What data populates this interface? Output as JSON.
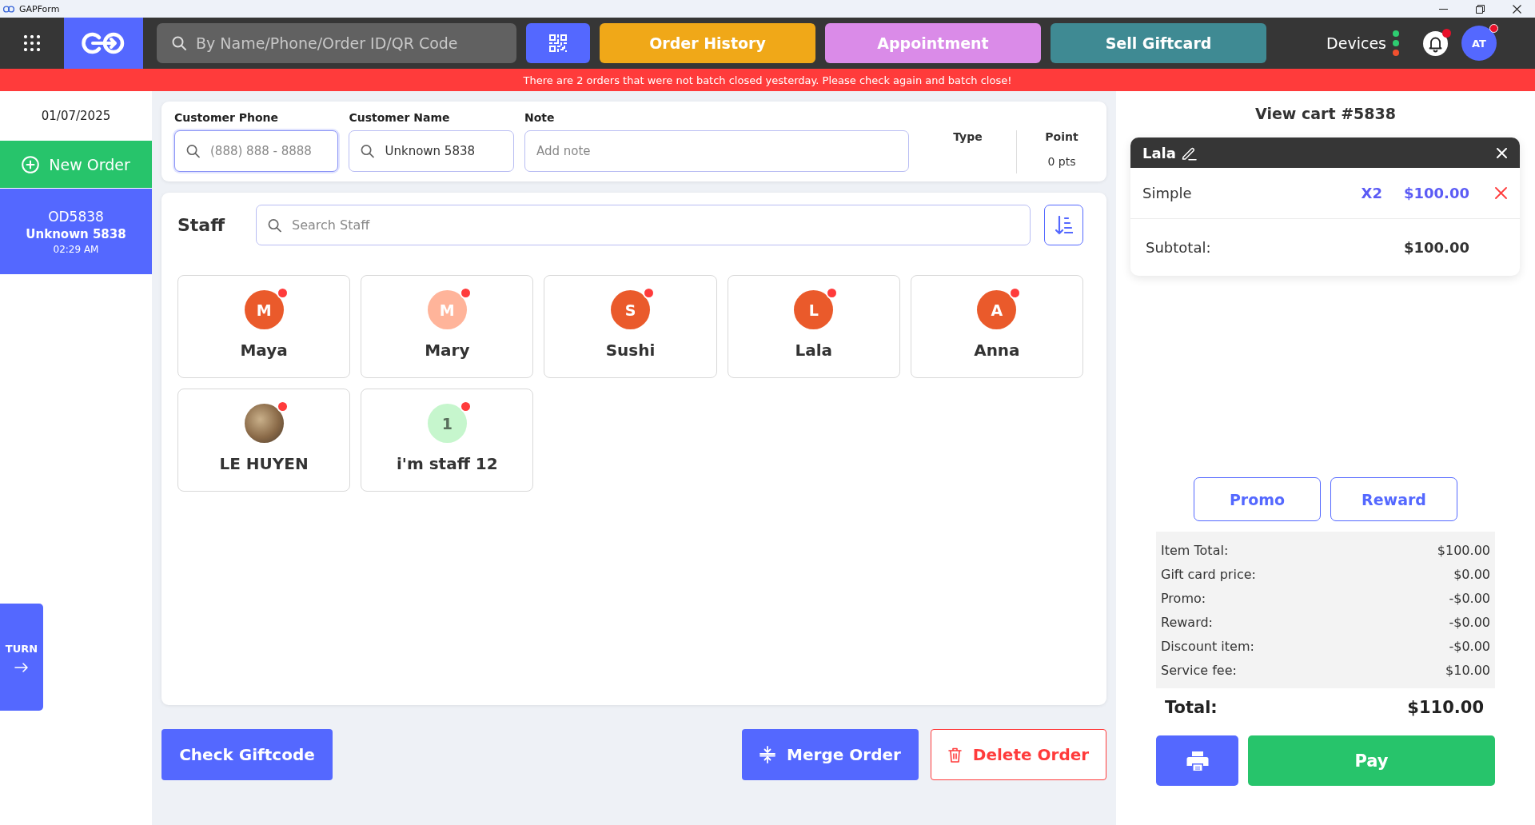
{
  "window": {
    "title": "GAPForm"
  },
  "nav": {
    "search": {
      "placeholder": "By Name/Phone/Order ID/QR Code"
    },
    "buttons": [
      {
        "label": "Order History",
        "color": "#f0a818"
      },
      {
        "label": "Appointment",
        "color": "#da8be8"
      },
      {
        "label": "Sell Giftcard",
        "color": "#3f8a93"
      }
    ],
    "devices": {
      "label": "Devices",
      "dots": [
        {
          "color": "#2ecc71"
        },
        {
          "color": "#2ecc71"
        },
        {
          "color": "#f0502f"
        }
      ]
    },
    "notifications": {
      "unread": true
    },
    "user": {
      "initials": "AT",
      "unread": true
    }
  },
  "banner": {
    "text": "There are 2 orders that were not batch closed yesterday. Please check again and batch close!"
  },
  "sidebar": {
    "date": "01/07/2025",
    "new_order": "New Order",
    "orders": [
      {
        "id": "OD5838",
        "customer": "Unknown 5838",
        "time": "02:29 AM",
        "selected": true
      }
    ],
    "turn": "TURN"
  },
  "customer": {
    "fields": [
      {
        "label": "Customer Phone",
        "kind": "search",
        "placeholder": "(888) 888 - 8888",
        "focused": true
      },
      {
        "label": "Customer Name",
        "kind": "search",
        "value": "Unknown 5838",
        "focused": false
      },
      {
        "label": "Note",
        "kind": "text",
        "placeholder": "Add note",
        "focused": false
      }
    ],
    "type": {
      "label": "Type"
    },
    "point": {
      "label": "Point",
      "value": "0 pts"
    }
  },
  "staff": {
    "title": "Staff",
    "search": {
      "placeholder": "Search Staff"
    },
    "members": [
      {
        "name": "Maya",
        "kind": "initial",
        "initial": "M",
        "color": "#ea5a2b",
        "alert": true
      },
      {
        "name": "Mary",
        "kind": "initial",
        "initial": "M",
        "color": "#ffb49a",
        "alert": true
      },
      {
        "name": "Sushi",
        "kind": "initial",
        "initial": "S",
        "color": "#ea5a2b",
        "alert": true
      },
      {
        "name": "Lala",
        "kind": "initial",
        "initial": "L",
        "color": "#ea5a2b",
        "alert": true
      },
      {
        "name": "Anna",
        "kind": "initial",
        "initial": "A",
        "color": "#ea5a2b",
        "alert": true
      },
      {
        "name": "LE HUYEN",
        "kind": "photo",
        "alert": true
      },
      {
        "name": "i'm staff 12",
        "kind": "initial",
        "initial": "1",
        "color": "#c6f6cd",
        "alert": true
      }
    ]
  },
  "actions": {
    "check_giftcode": "Check Giftcode",
    "merge_order": "Merge Order",
    "delete_order": "Delete Order"
  },
  "cart": {
    "title": "View cart #5838",
    "groups": [
      {
        "staff": "Lala",
        "items": [
          {
            "name": "Simple",
            "quantity": "X2",
            "price": "$100.00"
          }
        ],
        "subtotal_label": "Subtotal:",
        "subtotal": "$100.00"
      }
    ],
    "discounts": [
      {
        "label": "Promo"
      },
      {
        "label": "Reward"
      }
    ],
    "summary": [
      {
        "label": "Item Total:",
        "value": "$100.00"
      },
      {
        "label": "Gift card price:",
        "value": "$0.00"
      },
      {
        "label": "Promo:",
        "value": "-$0.00"
      },
      {
        "label": "Reward:",
        "value": "-$0.00"
      },
      {
        "label": "Discount item:",
        "value": "-$0.00"
      },
      {
        "label": "Service fee:",
        "value": "$10.00"
      }
    ],
    "total": {
      "label": "Total:",
      "value": "$110.00"
    },
    "pay": "Pay"
  }
}
